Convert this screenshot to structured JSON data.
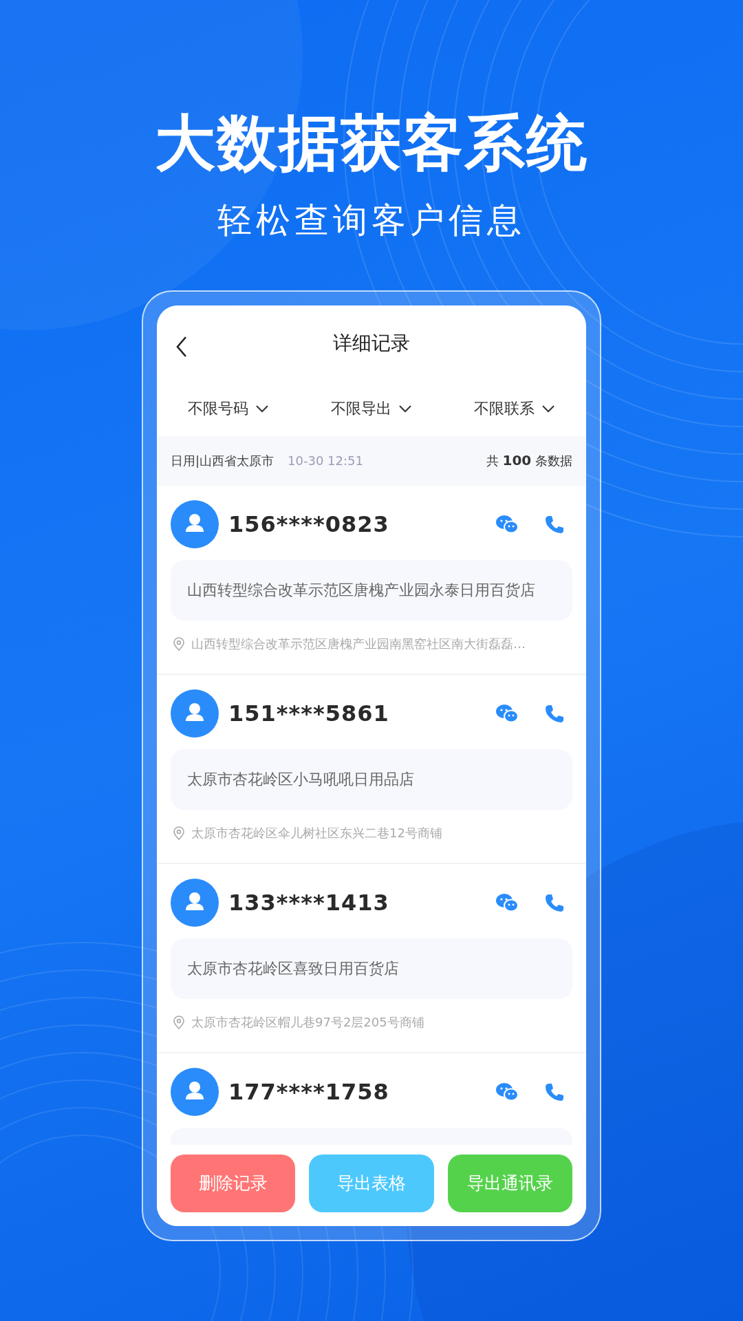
{
  "headline": {
    "title": "大数据获客系统",
    "subtitle": "轻松查询客户信息"
  },
  "screen": {
    "title": "详细记录",
    "back": true,
    "filters": [
      {
        "label": "不限号码"
      },
      {
        "label": "不限导出"
      },
      {
        "label": "不限联系"
      }
    ],
    "info_bar": {
      "category": "日用|山西省太原市",
      "time": "10-30 12:51",
      "count_prefix": "共",
      "count": "100",
      "count_suffix": "条数据"
    },
    "records": [
      {
        "phone": "156****0823",
        "store": "山西转型综合改革示范区唐槐产业园永泰日用百货店",
        "address": "山西转型综合改革示范区唐槐产业园南黑窑社区南大街磊磊…"
      },
      {
        "phone": "151****5861",
        "store": "太原市杏花岭区小马吼吼日用品店",
        "address": "太原市杏花岭区伞儿树社区东兴二巷12号商铺"
      },
      {
        "phone": "133****1413",
        "store": "太原市杏花岭区喜致日用百货店",
        "address": "太原市杏花岭区帽儿巷97号2层205号商铺"
      },
      {
        "phone": "177****1758"
      }
    ],
    "buttons": [
      {
        "label": "删除记录",
        "kind": "delete"
      },
      {
        "label": "导出表格",
        "kind": "sheet"
      },
      {
        "label": "导出通讯录",
        "kind": "contacts"
      }
    ]
  }
}
